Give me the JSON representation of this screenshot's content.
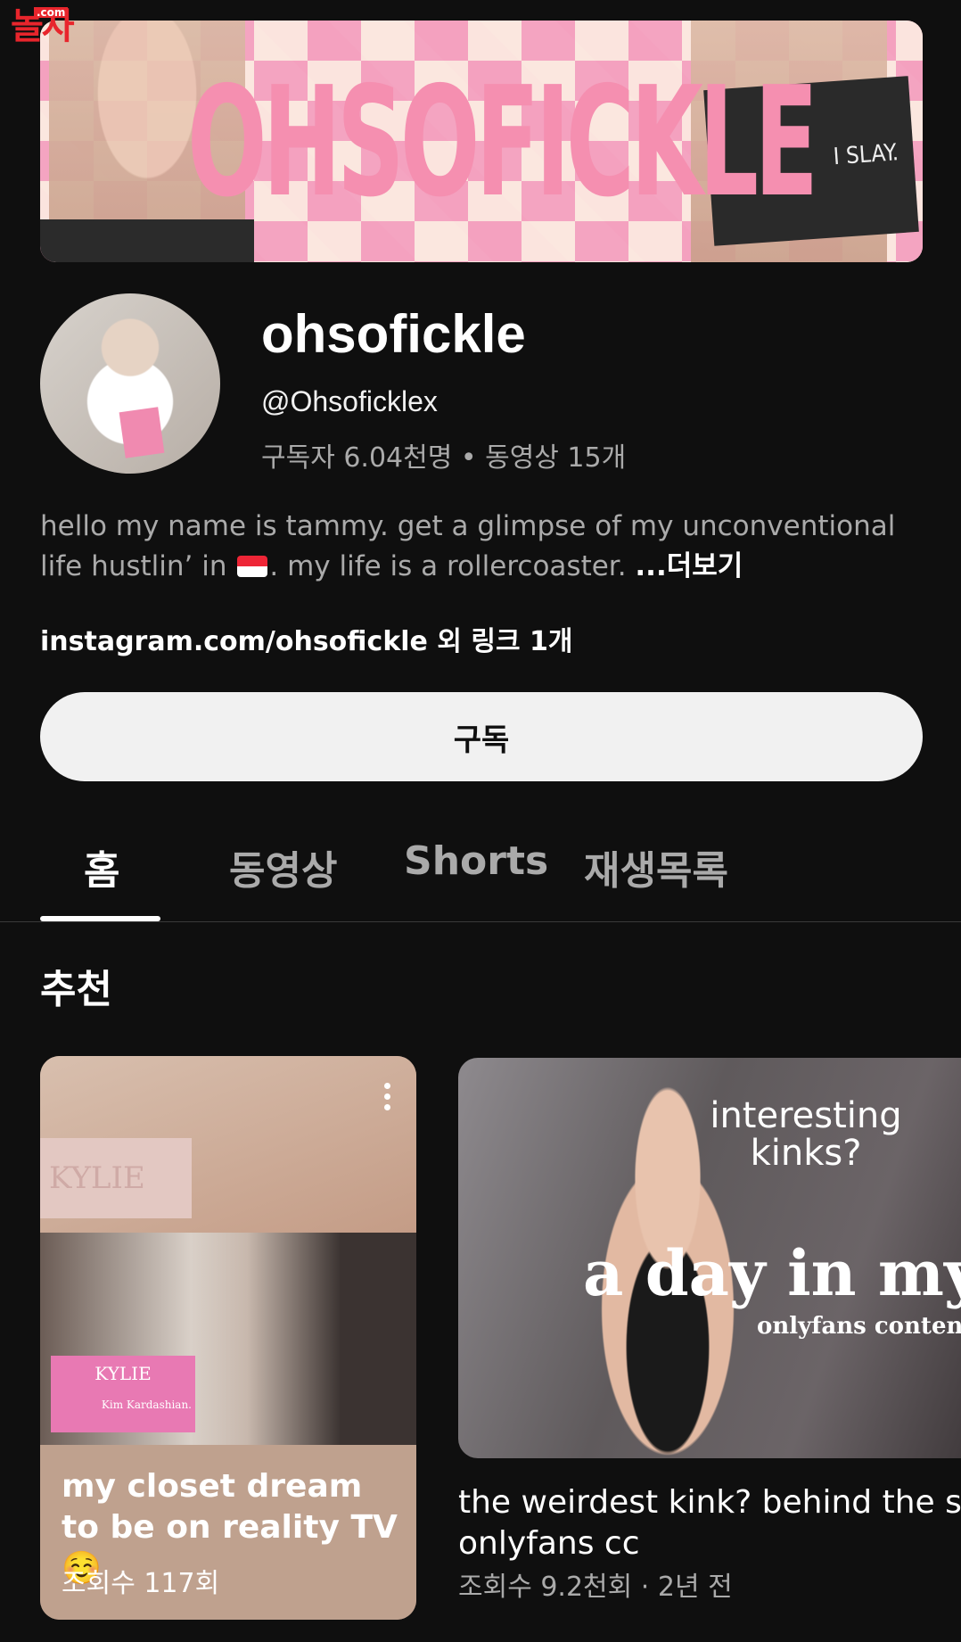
{
  "watermark": {
    "text": "놀자",
    "sub": ".com"
  },
  "banner": {
    "wordmark": "OHSOFICKLE",
    "book_text": "I SLAY."
  },
  "channel": {
    "name": "ohsofickle",
    "handle": "@Ohsoficklex",
    "stats": "구독자 6.04천명 • 동영상 15개",
    "description_part1": "hello my name is tammy. get a glimpse of my unconventional life hustlin’ in ",
    "description_part2": ". my life is a rollercoaster. ",
    "more": "...더보기",
    "links": "instagram.com/ohsofickle 외 링크 1개",
    "subscribe": "구독"
  },
  "tabs": [
    {
      "label": "홈",
      "active": true
    },
    {
      "label": "동영상"
    },
    {
      "label": "Shorts"
    },
    {
      "label": "재생목록"
    }
  ],
  "section": {
    "title": "추천"
  },
  "videos": [
    {
      "title": "my closet dream to be on reality TV ☺️",
      "meta": "조회수 117회",
      "thumb_text_1": "KYLIE",
      "thumb_text_2": "KYLIE",
      "thumb_caption": "Kim Kardashian."
    },
    {
      "title": "the weirdest kink? behind the scenes onlyfans cc",
      "title_line2": "onlyfans cc",
      "meta": "조회수 9.2천회 · 2년 전",
      "thumb_text_1": "interesting kinks?",
      "thumb_text_2": "a day in my l",
      "thumb_text_3": "onlyfans content"
    }
  ],
  "icons": {
    "menu": "more-vertical-icon",
    "flag": "singapore-flag-icon"
  },
  "colors": {
    "background": "#0f0f0f",
    "subscribe_bg": "#f1f1f1",
    "secondary_text": "#aaaaaa"
  }
}
